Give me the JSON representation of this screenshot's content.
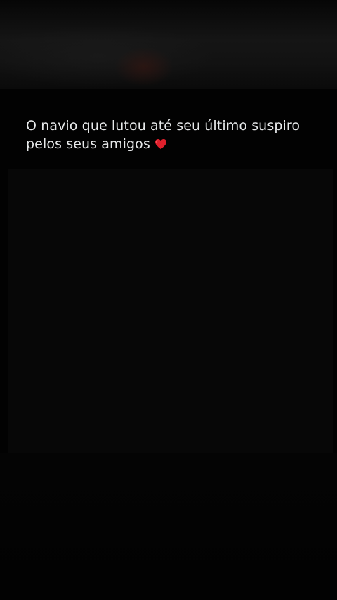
{
  "post": {
    "caption_line1": "O navio que lutou até seu último suspiro",
    "caption_line2": "pelos seus amigos",
    "emoji": "heart-icon"
  },
  "colors": {
    "background": "#040404",
    "text": "#e7e9ea",
    "heart": "#e0202c"
  }
}
